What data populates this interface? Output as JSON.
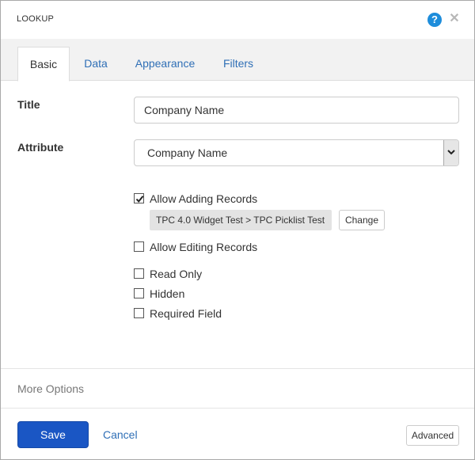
{
  "header": {
    "title": "LOOKUP",
    "help_icon": "question-circle-icon",
    "help_glyph": "?",
    "close_icon": "close-icon",
    "close_glyph": "✕",
    "help_color": "#1e8ddb"
  },
  "tabs": [
    {
      "label": "Basic",
      "active": true
    },
    {
      "label": "Data",
      "active": false
    },
    {
      "label": "Appearance",
      "active": false
    },
    {
      "label": "Filters",
      "active": false
    }
  ],
  "form": {
    "title_label": "Title",
    "title_value": "Company Name",
    "attribute_label": "Attribute",
    "attribute_value": "Company Name",
    "attribute_arrow_icon": "chevron-down-icon",
    "allow_adding": {
      "label": "Allow Adding Records",
      "checked": true
    },
    "picklist": "TPC 4.0 Widget Test > TPC Picklist Test",
    "change_label": "Change",
    "allow_editing": {
      "label": "Allow Editing Records",
      "checked": false
    },
    "read_only": {
      "label": "Read Only",
      "checked": false
    },
    "hidden": {
      "label": "Hidden",
      "checked": false
    },
    "required": {
      "label": "Required Field",
      "checked": false
    }
  },
  "more_options_label": "More Options",
  "footer": {
    "save_label": "Save",
    "cancel_label": "Cancel",
    "advanced_label": "Advanced",
    "primary_color": "#1a56c4",
    "link_color": "#2f6fb6"
  }
}
